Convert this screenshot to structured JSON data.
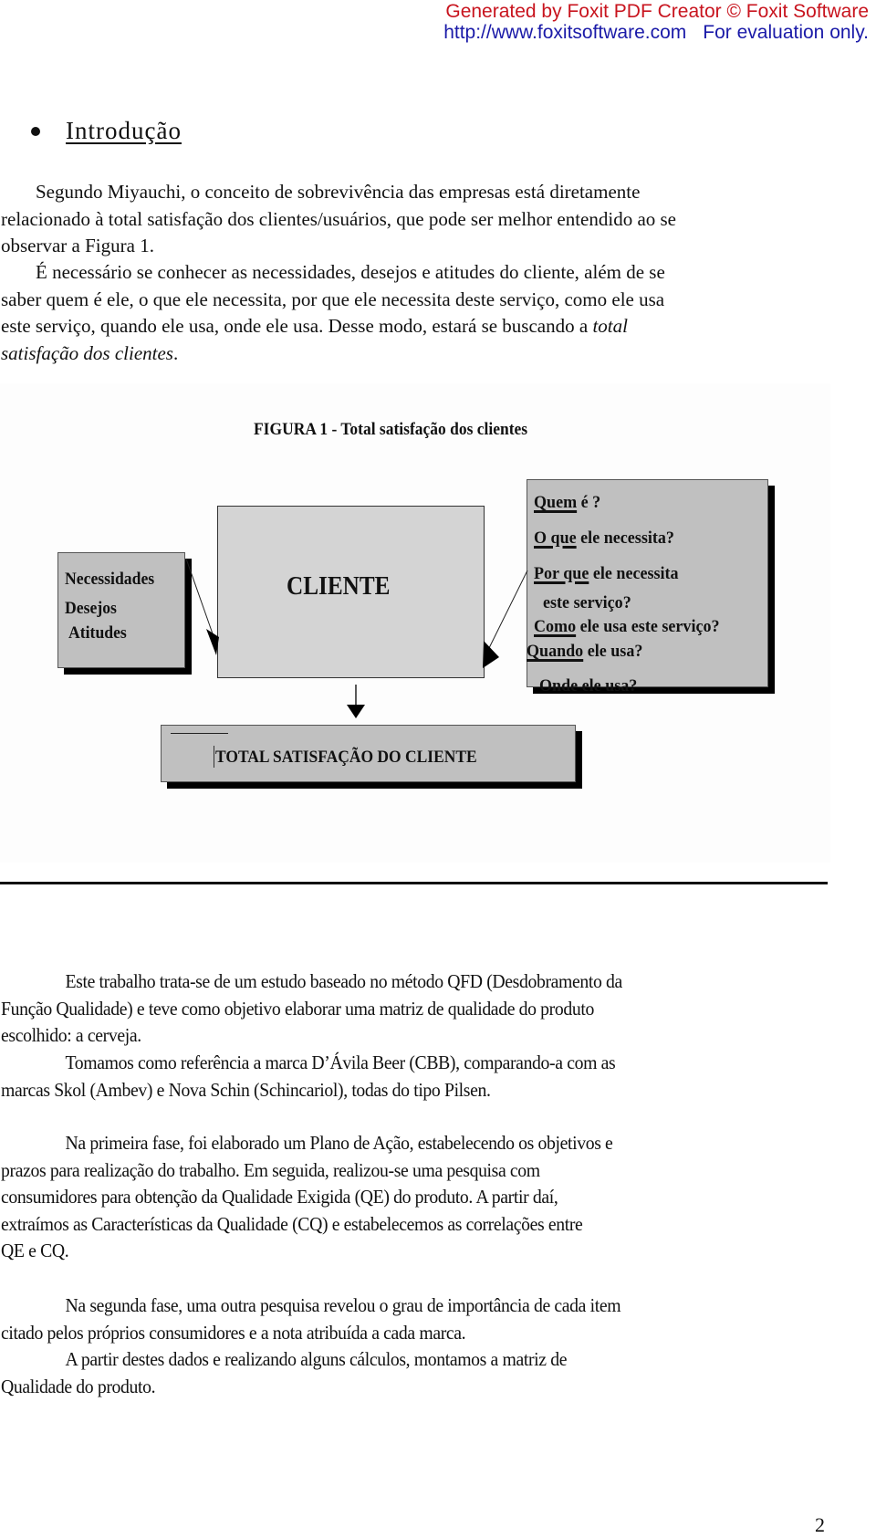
{
  "watermark": {
    "line1": "Generated by Foxit PDF Creator © Foxit Software",
    "url": "http://www.foxitsoftware.com",
    "note": "For evaluation only.",
    "colors": {
      "line1": "#c8141e",
      "line2": "#1a1aa8"
    }
  },
  "heading": {
    "title": "Introdução"
  },
  "intro": {
    "p1_lines": [
      "Segundo Miyauchi, o conceito de sobrevivência das empresas está diretamente",
      "relacionado à total satisfação dos clientes/usuários, que pode ser melhor entendido ao se",
      "observar a Figura 1."
    ],
    "p2_lines": [
      "É necessário se conhecer as necessidades, desejos e atitudes do cliente, além de se",
      "saber quem é ele, o que ele necessita, por que ele necessita deste serviço, como ele usa",
      "este serviço, quando ele usa, onde ele usa. Desse modo, estará se buscando a "
    ],
    "p2_italic_end": "total",
    "p2_italic_line": "satisfação dos clientes",
    "p2_final": "."
  },
  "figure": {
    "title": "FIGURA 1 - Total satisfação dos clientes",
    "left_box": [
      "Necessidades",
      "Desejos",
      "Atitudes"
    ],
    "center_box": "CLIENTE",
    "right_box": [
      {
        "u": "Quem",
        "rest": " é ?"
      },
      {
        "u": "O que",
        "rest": " ele necessita?"
      },
      {
        "u": "Por que",
        "rest": " ele necessita"
      },
      {
        "u": "",
        "rest": "este serviço?"
      },
      {
        "u": "Como",
        "rest": " ele usa este serviço?"
      },
      {
        "u": "Quando",
        "rest": " ele usa?"
      },
      {
        "u": "",
        "rest": "Onde ele usa?"
      }
    ],
    "bottom_box": "TOTAL SATISFAÇÃO DO CLIENTE"
  },
  "body": {
    "p1_lines": [
      "Este trabalho trata-se de um estudo baseado no método QFD (Desdobramento da",
      "Função Qualidade) e teve como objetivo elaborar uma matriz de qualidade do produto",
      "escolhido: a cerveja."
    ],
    "p2_lines": [
      "Tomamos como referência a marca D’Ávila Beer (CBB), comparando-a com as",
      "marcas Skol (Ambev) e Nova Schin (Schincariol), todas do tipo Pilsen."
    ],
    "p3_lines": [
      "Na primeira fase, foi elaborado um Plano de Ação, estabelecendo os objetivos e",
      "prazos para realização do trabalho. Em seguida, realizou-se uma pesquisa com",
      "consumidores para obtenção da Qualidade Exigida (QE) do produto. A partir daí,",
      "extraímos as Características da Qualidade (CQ) e estabelecemos as correlações entre",
      "QE e CQ."
    ],
    "p4_lines": [
      "Na segunda fase, uma outra pesquisa revelou o grau de importância de cada item",
      "citado pelos próprios consumidores e a nota atribuída a cada marca."
    ],
    "p5_lines": [
      "A partir destes dados e realizando alguns cálculos, montamos a matriz de",
      "Qualidade do produto."
    ]
  },
  "page_number": "2"
}
